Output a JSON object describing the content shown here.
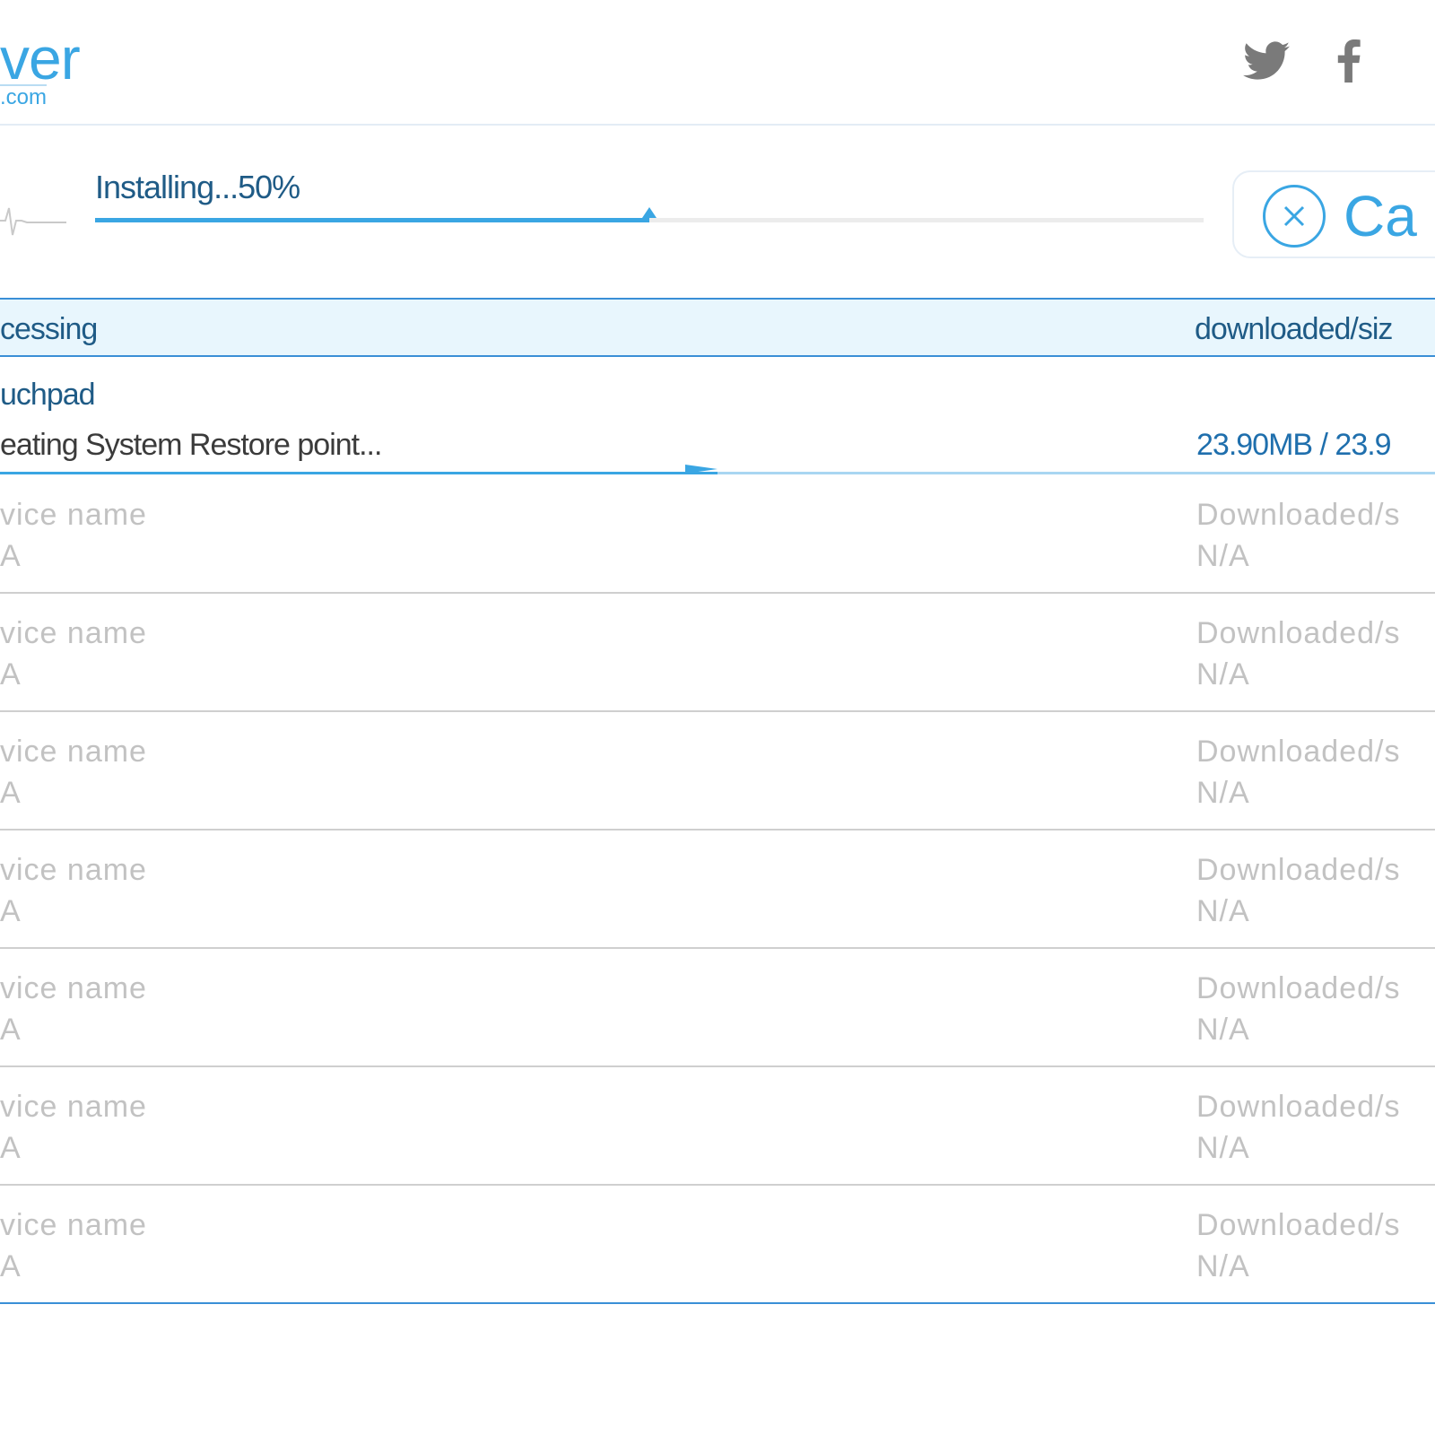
{
  "header": {
    "logo_word": "ver",
    "logo_domain": "com",
    "social": [
      {
        "name": "twitter",
        "icon": "twitter-icon"
      },
      {
        "name": "facebook",
        "icon": "facebook-icon"
      }
    ]
  },
  "status": {
    "text": "Installing...50%",
    "progress_fraction": 0.5,
    "cancel_label": "Ca",
    "cancel_icon": "close-icon"
  },
  "table": {
    "header_processing": "cessing",
    "header_size": "downloaded/siz",
    "active": {
      "name": "uchpad",
      "status": "eating System Restore point...",
      "size": "23.90MB / 23.9",
      "progress_fraction": 0.5
    },
    "placeholders": [
      {
        "label": "vice name",
        "value": "A",
        "size_label": "Downloaded/s",
        "size_value": "N/A"
      },
      {
        "label": "vice name",
        "value": "A",
        "size_label": "Downloaded/s",
        "size_value": "N/A"
      },
      {
        "label": "vice name",
        "value": "A",
        "size_label": "Downloaded/s",
        "size_value": "N/A"
      },
      {
        "label": "vice name",
        "value": "A",
        "size_label": "Downloaded/s",
        "size_value": "N/A"
      },
      {
        "label": "vice name",
        "value": "A",
        "size_label": "Downloaded/s",
        "size_value": "N/A"
      },
      {
        "label": "vice name",
        "value": "A",
        "size_label": "Downloaded/s",
        "size_value": "N/A"
      },
      {
        "label": "vice name",
        "value": "A",
        "size_label": "Downloaded/s",
        "size_value": "N/A"
      }
    ]
  },
  "colors": {
    "accent": "#3aa6e3",
    "text_dark": "#1f5b86",
    "header_bg": "#e8f6fd",
    "placeholder": "#c2c2c2"
  }
}
